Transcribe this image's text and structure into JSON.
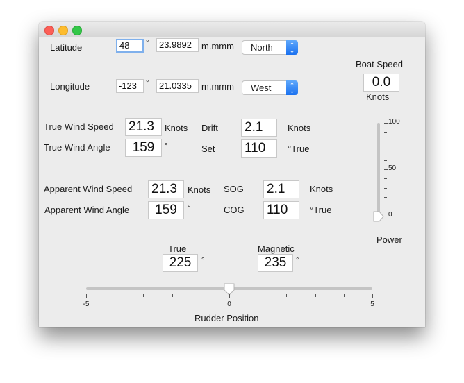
{
  "window": {
    "controls": [
      "close",
      "minimize",
      "maximize"
    ]
  },
  "position": {
    "latitude": {
      "label": "Latitude",
      "degrees": "48",
      "minutes": "23.9892",
      "minutes_unit": "m.mmm",
      "hemisphere": "North",
      "degree_symbol": "°"
    },
    "longitude": {
      "label": "Longitude",
      "degrees": "-123",
      "minutes": "21.0335",
      "minutes_unit": "m.mmm",
      "hemisphere": "West",
      "degree_symbol": "°"
    }
  },
  "boat_speed": {
    "label": "Boat Speed",
    "value": "0.0",
    "unit": "Knots"
  },
  "true_wind": {
    "speed_label": "True Wind Speed",
    "speed_value": "21.3",
    "speed_unit": "Knots",
    "angle_label": "True Wind Angle",
    "angle_value": "159",
    "angle_unit": "°"
  },
  "current": {
    "drift_label": "Drift",
    "drift_value": "2.1",
    "drift_unit": "Knots",
    "set_label": "Set",
    "set_value": "110",
    "set_unit": "°True"
  },
  "apparent_wind": {
    "speed_label": "Apparent Wind Speed",
    "speed_value": "21.3",
    "speed_unit": "Knots",
    "angle_label": "Apparent Wind Angle",
    "angle_value": "159",
    "angle_unit": "°"
  },
  "ground": {
    "sog_label": "SOG",
    "sog_value": "2.1",
    "sog_unit": "Knots",
    "cog_label": "COG",
    "cog_value": "110",
    "cog_unit": "°True"
  },
  "heading": {
    "true_label": "True",
    "true_value": "225",
    "magnetic_label": "Magnetic",
    "magnetic_value": "235",
    "degree_symbol": "°"
  },
  "power_slider": {
    "label": "Power",
    "min": 0,
    "max": 100,
    "value": 0,
    "tick_labels": [
      "100",
      "50",
      "0"
    ]
  },
  "rudder_slider": {
    "label": "Rudder Position",
    "min": -5,
    "max": 5,
    "value": 0,
    "tick_labels": [
      "-5",
      "0",
      "5"
    ]
  }
}
